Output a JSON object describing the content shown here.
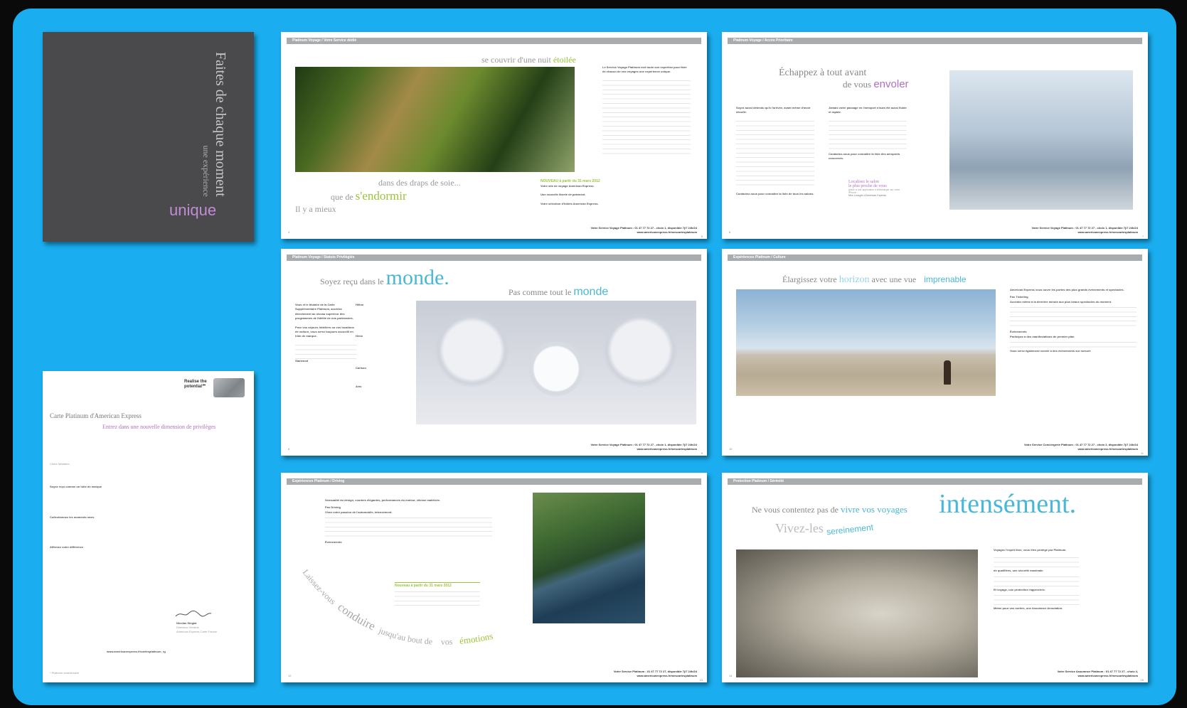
{
  "cover": {
    "title": "Faites de chaque moment",
    "subtitle": "une expérience",
    "emphasis": "unique"
  },
  "letter": {
    "brand": "Realise the potential℠",
    "title": "Carte Platinum d'American Express",
    "subtitle": "Entrez dans une nouvelle dimension de privilèges",
    "greeting": "Chère Madame,",
    "heading1": "Soyez reçu comme un hôte de marque",
    "heading2": "Collectionnez les moments rares",
    "heading3": "Affirmez votre différence",
    "signature_name": "Nicolas Singial",
    "signature_role": "Directeur Général",
    "signature_company": "American Express Carte France",
    "contact": "www.americanexpress.fr/cartesplatinum_rg",
    "footnote": "* Platinum anniversaire"
  },
  "pages": [
    {
      "header": "Platinum Voyage / Votre Service dédié",
      "line1a": "se",
      "line1b": "couvrir d'une nuit",
      "line1c": "étoilée",
      "line2": "dans des draps de soie...",
      "line3a": "que de",
      "line3b": "s'endormir",
      "line4": "Il y a mieux",
      "side_heading": "Le Service Voyage Platinum met toute son expertise pour faire de chacun de vos voyages une expérience unique.",
      "news_heading": "NOUVEAU à partir du 31 mars 2012",
      "news1": "Votre site de voyage American Express.",
      "news2": "Une nouvelle liberté de paiement.",
      "news3": "Votre sélection d'hôtels American Express.",
      "footer": "Votre Service Voyage Platinum : 01 47 77 72 27 - choix 1, disponible 7j/7 24h/24",
      "url": "www.americanexpress.fr/mescartesplatinum",
      "left_num": "4",
      "right_num": "5"
    },
    {
      "header": "Platinum Voyage / Accès Prioritaire",
      "line1": "Échappez à tout avant",
      "line2a": "de vous",
      "line2b": "envoler",
      "col1_heading": "Soyez aussi détendu qu'à l'arrivée, avant même d'avoir décollé.",
      "col2_heading": "Jamais votre passage en l'aéroport n'aura été aussi fluide et rapide.",
      "col2_contact": "Contactez-nous pour connaître la liste des aéroports concernés.",
      "col1_contact": "Contactez-nous pour connaître la liste de tous les salons.",
      "lounge_a": "Localisez le salon",
      "lounge_b": "le plus proche de vous",
      "lounge_c": "grâce à une application à télécharger sur votre iPhone :",
      "lounge_d": "Mes Lounges d'American Express",
      "footer": "Votre Service Voyage Platinum : 01 47 77 72 27 - choix 1, disponible 7j/7 24h/24",
      "url": "www.americanexpress.fr/mescartesplatinum",
      "left_num": "6",
      "right_num": "7"
    },
    {
      "header": "Platinum Voyage / Statuts Privilégiés",
      "line1a": "Soyez reçu dans le",
      "line1b": "monde.",
      "line2a": "Pas comme tout le",
      "line2b": "monde",
      "col_heading": "Vous et le titulaire de la Carte Supplémentaire Platinum, accédez directement au niveau supérieur des programmes de fidélité de nos partenaires.",
      "col_bold": "Pour vos séjours hôteliers ou vos locations de voiture, vous serez toujours accueilli en hôte de marque.",
      "sub1": "Starwood",
      "sub2": "Hilton",
      "sub3": "Hertz",
      "sub4": "Carlson",
      "sub5": "Avis",
      "footer": "Votre Service Voyage Platinum : 01 47 77 72 27 - choix 1, disponible 7j/7 24h/24",
      "url": "www.americanexpress.fr/mescartesplatinum",
      "left_num": "8",
      "right_num": "9"
    },
    {
      "header": "Expériences Platinum / Culture",
      "line1a": "Élargissez votre",
      "line1b": "horizon",
      "line1c": "avec une vue",
      "line1d": "imprenable",
      "side_heading": "American Express vous ouvre les portes des plus grands événements et spectacles.",
      "sub1": "Fan Ticketing",
      "bold1": "Accédez même à la dernière minute aux plus beaux spectacles du moment.",
      "bold2": "Participez à des manifestations de premier plan",
      "bold3": "Vous serez également convié à des événements sur mesure",
      "sub2": "Événements",
      "footer": "Votre Service Conciergerie Platinum : 01 47 77 72 27 - choix 2, disponible 7j/7 24h/24",
      "url": "www.americanexpress.fr/mescartesplatinum",
      "left_num": "10",
      "right_num": "11"
    },
    {
      "header": "Expériences Platinum / Driving",
      "side_heading": "Sensualité du design, courbes élégantes, performances du moteur, vitesse maîtrisée.",
      "sub1": "Fan Driving",
      "bold1": "Vivez votre passion de l'automobile, intensément.",
      "sub2": "Événements",
      "news_heading": "Nouveau à partir du 31 mars 2012",
      "curve_words": [
        "Laissez-vous",
        "conduire",
        "jusqu'au bout de",
        "vos",
        "émotions"
      ],
      "footer": "Votre Service Platinum : 01 47 77 72 27, disponible 7j/7 24h/24",
      "url": "www.americanexpress.fr/mescartesplatinum",
      "left_num": "12",
      "right_num": "13"
    },
    {
      "header": "Protection Platinum / Sérénité",
      "line1a": "Ne vous contentez pas de",
      "line1b": "vivre vos voyages",
      "line1c": "intensément.",
      "line2a": "Vivez-les",
      "line2b": "sereinement",
      "side_heading": "Voyagez l'esprit libre, vous êtes protégé par Platinum.",
      "bold1": "de qualifiées, une sécurité maximale.",
      "bold2": "Et voyage, une protection rapprochée.",
      "bold3": "Même pour vos sorties, une Assurance Annulation.",
      "footer": "Votre Service Assurance Platinum : 01 47 77 72 27 - choix 4,",
      "url": "www.americanexpress.fr/mescartesplatinum",
      "left_num": "14",
      "right_num": "15"
    }
  ],
  "colors": {
    "frame": "#1aaef0",
    "cover": "#4a4a4c",
    "green": "#9ac43a",
    "purple": "#b06ec2",
    "blue": "#49b8d6"
  }
}
